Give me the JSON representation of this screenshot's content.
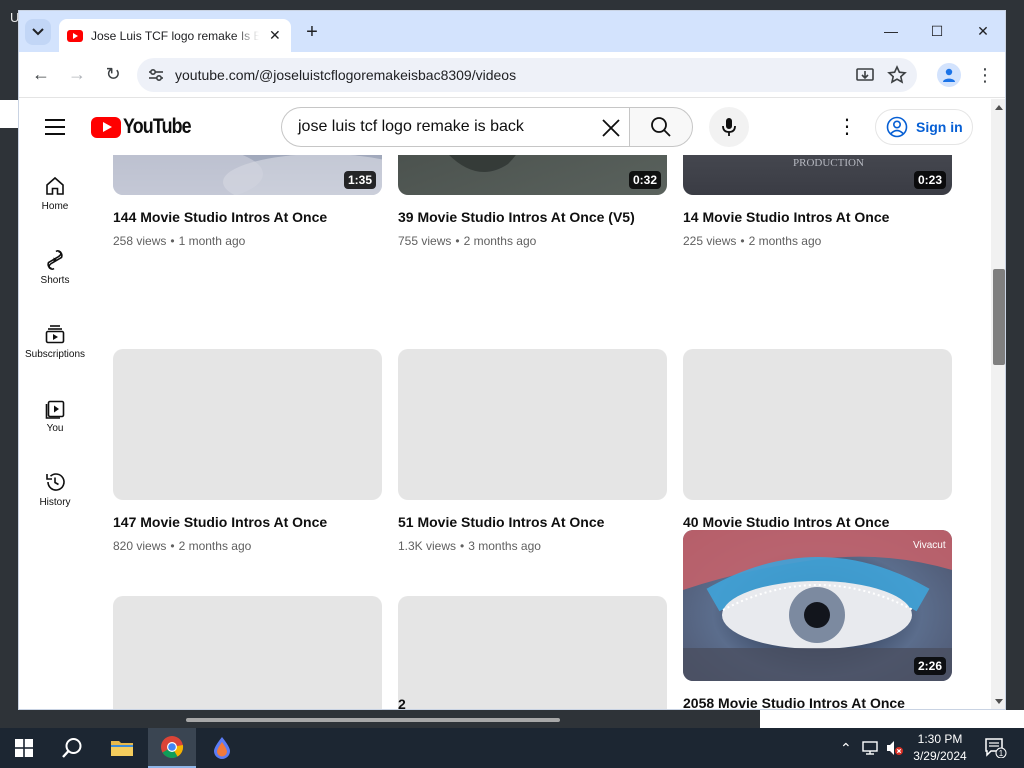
{
  "desktop": {
    "corner_text": "U"
  },
  "browser": {
    "tab": {
      "title": "Jose Luis TCF logo remake Is Back",
      "close_glyph": "✕"
    },
    "new_tab_glyph": "+",
    "window_controls": {
      "minimize": "—",
      "maximize": "☐",
      "close": "✕"
    },
    "nav": {
      "back": "←",
      "forward": "→",
      "reload": "↻"
    },
    "url": "youtube.com/@joseluistcflogoremakeisbac8309/videos"
  },
  "youtube": {
    "logo_text": "YouTube",
    "search": {
      "query": "jose luis tcf logo remake is back"
    },
    "sign_in_label": "Sign in",
    "guide": [
      {
        "label": "Home",
        "icon": "home-icon"
      },
      {
        "label": "Shorts",
        "icon": "shorts-icon"
      },
      {
        "label": "Subscriptions",
        "icon": "subscriptions-icon"
      },
      {
        "label": "You",
        "icon": "you-icon"
      },
      {
        "label": "History",
        "icon": "history-icon"
      }
    ],
    "videos": [
      {
        "title": "144 Movie Studio Intros At Once",
        "views": "258 views",
        "age": "1 month ago",
        "duration": "1:35"
      },
      {
        "title": "39 Movie Studio Intros At Once (V5)",
        "views": "755 views",
        "age": "2 months ago",
        "duration": "0:32"
      },
      {
        "title": "14 Movie Studio Intros At Once",
        "views": "225 views",
        "age": "2 months ago",
        "duration": "0:23"
      },
      {
        "title": "147 Movie Studio Intros At Once",
        "views": "820 views",
        "age": "2 months ago",
        "duration": ""
      },
      {
        "title": "51 Movie Studio Intros At Once",
        "views": "1.3K views",
        "age": "3 months ago",
        "duration": ""
      },
      {
        "title": "40 Movie Studio Intros At Once",
        "views": "",
        "age": "",
        "duration": ""
      },
      {
        "title": "",
        "views": "",
        "age": "",
        "duration": ""
      },
      {
        "title": "2",
        "views": "",
        "age": "",
        "duration": ""
      },
      {
        "title": "2058 Movie Studio Intros At Once",
        "views": "",
        "age": "",
        "duration": "2:26",
        "watermark": "Vivacut"
      }
    ],
    "meta_separator": "•"
  },
  "taskbar": {
    "time": "1:30 PM",
    "date": "3/29/2024",
    "notification_count": "1"
  },
  "colors": {
    "yt_red": "#ff0000",
    "link_blue": "#065fd4",
    "tabstrip": "#d3e3fd",
    "taskbar": "#1c2632"
  }
}
